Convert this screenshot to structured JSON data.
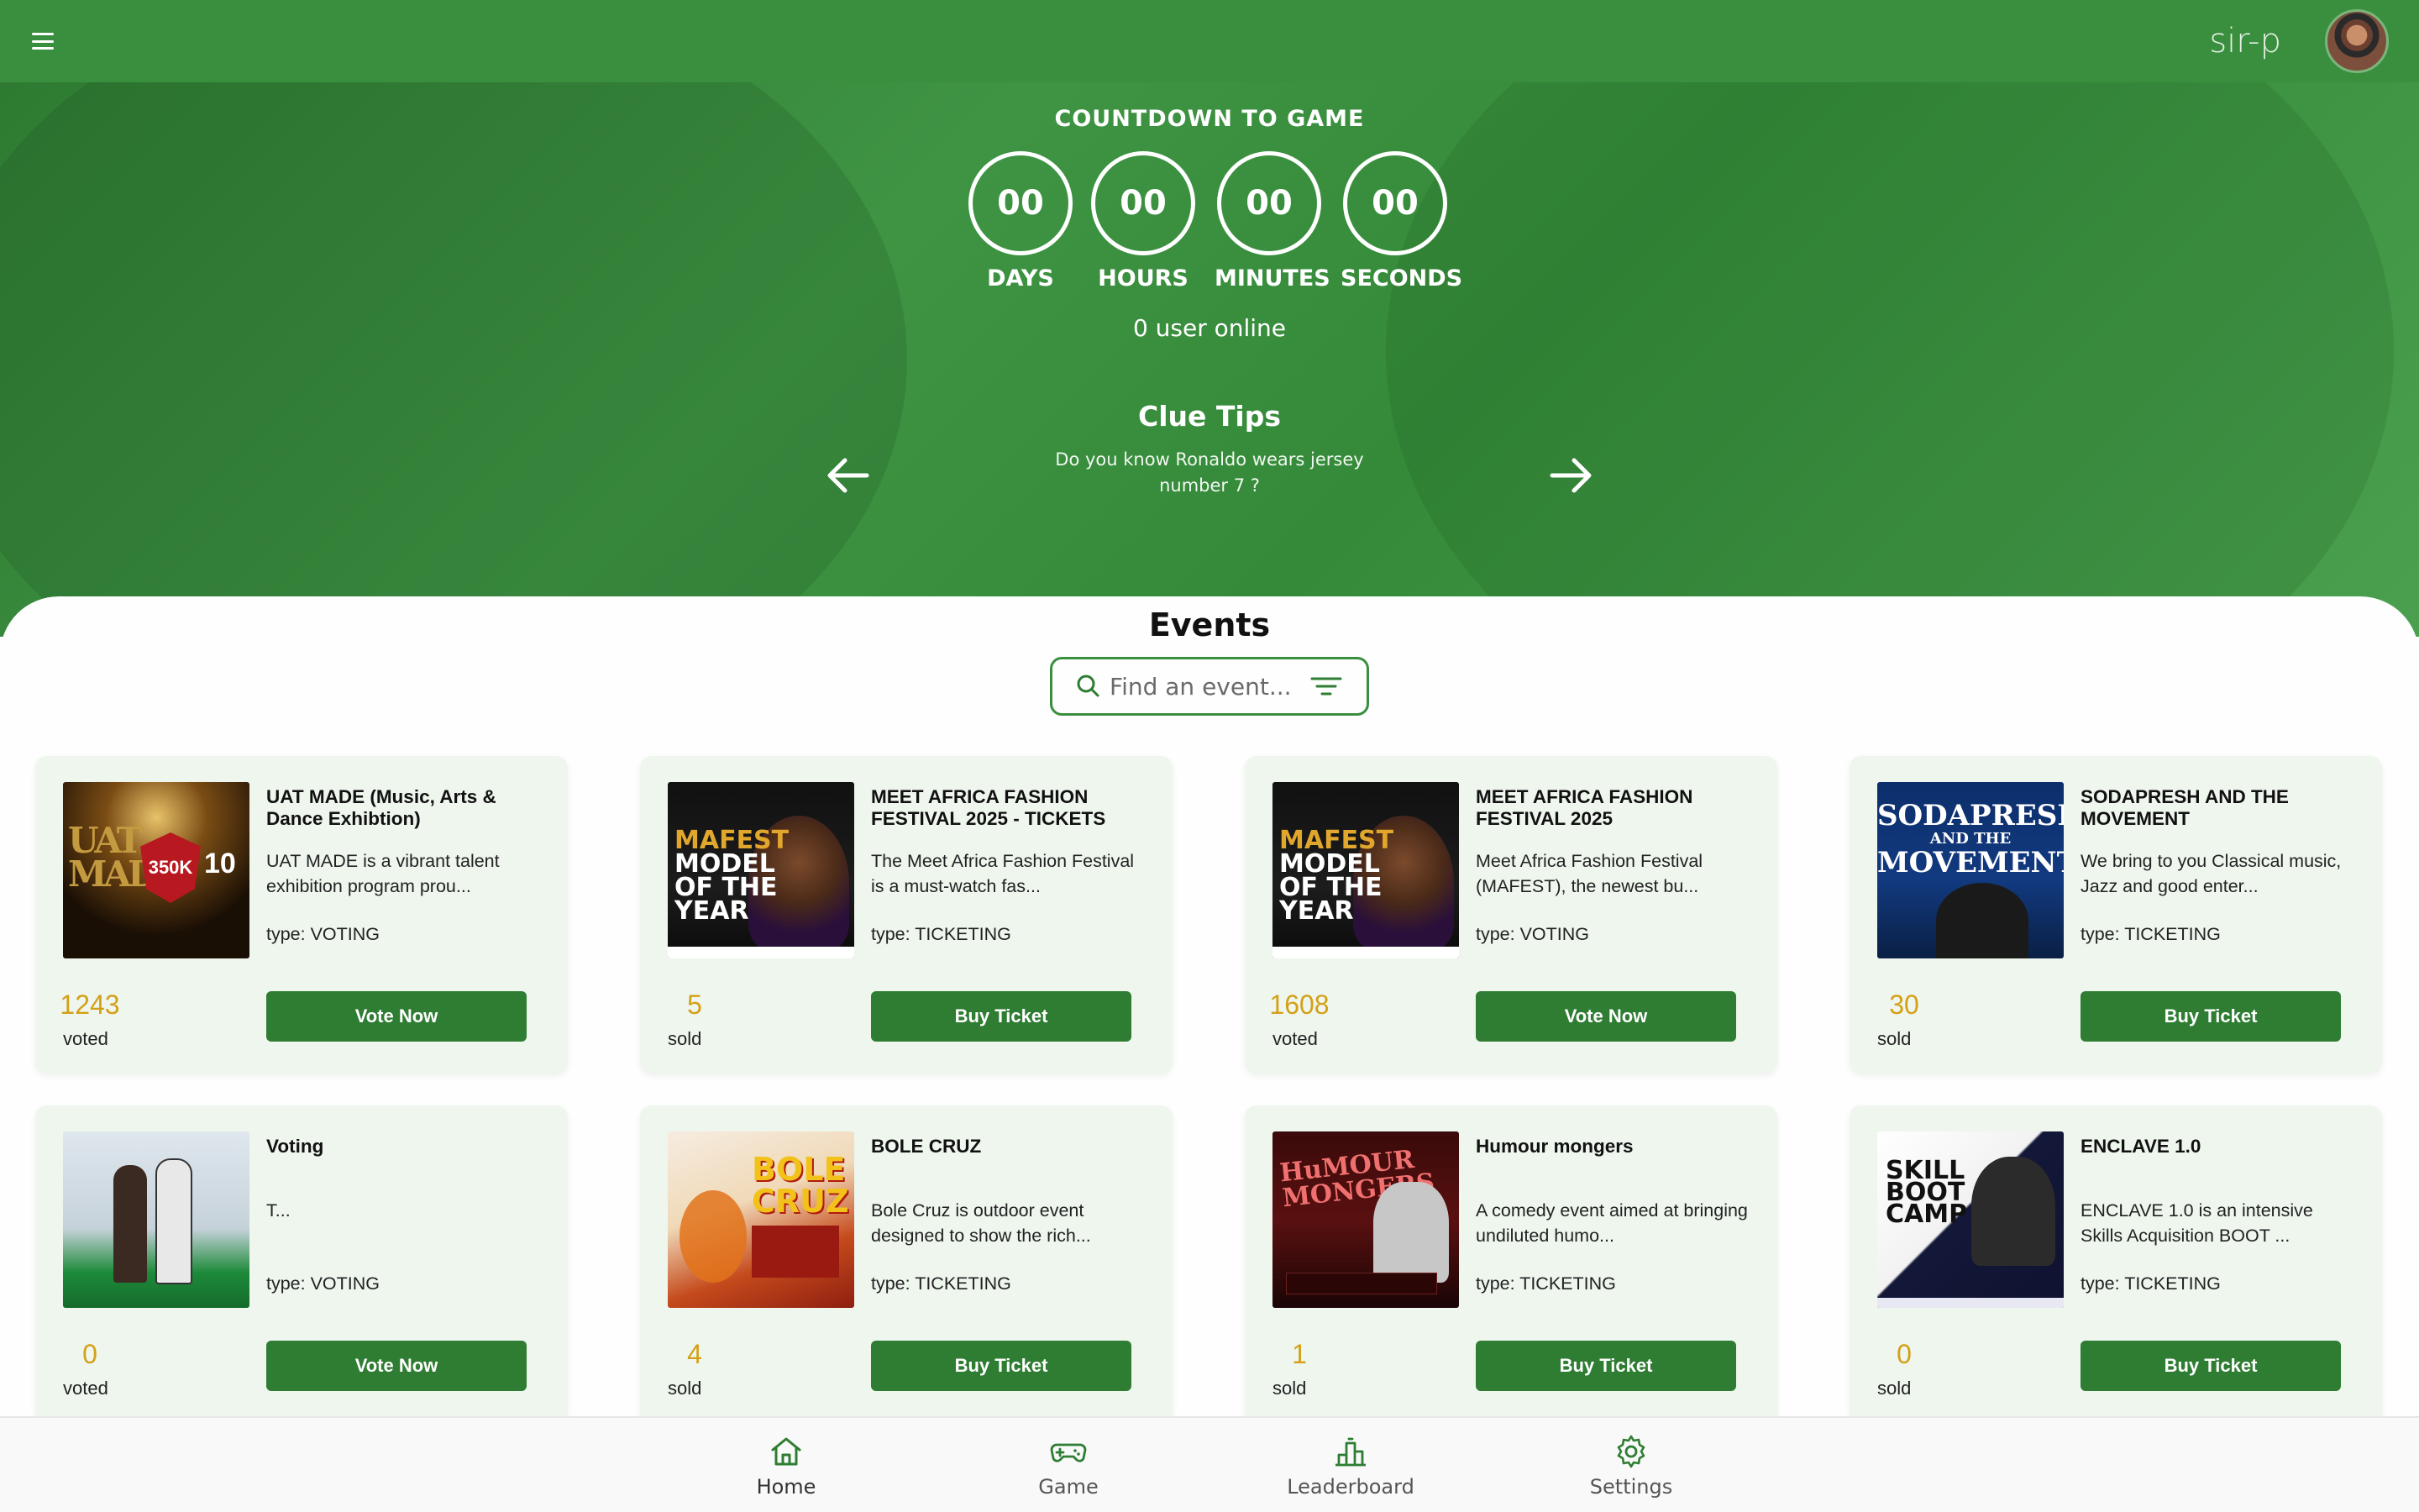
{
  "header": {
    "username": "sir-p"
  },
  "countdown": {
    "title": "COUNTDOWN TO GAME",
    "units": [
      {
        "value": "00",
        "label": "DAYS"
      },
      {
        "value": "00",
        "label": "HOURS"
      },
      {
        "value": "00",
        "label": "MINUTES"
      },
      {
        "value": "00",
        "label": "SECONDS"
      }
    ],
    "online": "0 user online"
  },
  "clue": {
    "title": "Clue Tips",
    "text": "Do you know Ronaldo wears jersey number 7 ?"
  },
  "events": {
    "title": "Events",
    "search_placeholder": "Find an event...",
    "cards": [
      {
        "title": "UAT MADE (Music, Arts & Dance Exhibtion)",
        "desc": "UAT MADE is a vibrant talent exhibition program prou...",
        "type": "type: VOTING",
        "count": "1243",
        "count_label": "voted",
        "button": "Vote Now"
      },
      {
        "title": "MEET AFRICA FASHION FESTIVAL 2025 - TICKETS",
        "desc": "The Meet Africa Fashion Festival is a must-watch fas...",
        "type": "type: TICKETING",
        "count": "5",
        "count_label": "sold",
        "button": "Buy Ticket"
      },
      {
        "title": "MEET AFRICA FASHION FESTIVAL 2025",
        "desc": "Meet Africa Fashion Festival (MAFEST), the newest bu...",
        "type": "type: VOTING",
        "count": "1608",
        "count_label": "voted",
        "button": "Vote Now"
      },
      {
        "title": "SODAPRESH AND THE MOVEMENT",
        "desc": "We bring to you Classical music, Jazz and good enter...",
        "type": "type: TICKETING",
        "count": "30",
        "count_label": "sold",
        "button": "Buy Ticket"
      },
      {
        "title": "Voting",
        "desc": "T...",
        "type": "type: VOTING",
        "count": "0",
        "count_label": "voted",
        "button": "Vote Now"
      },
      {
        "title": "BOLE CRUZ",
        "desc": "Bole Cruz is outdoor event designed to show the rich...",
        "type": "type: TICKETING",
        "count": "4",
        "count_label": "sold",
        "button": "Buy Ticket"
      },
      {
        "title": "Humour mongers",
        "desc": "A comedy event aimed at bringing undiluted humo...",
        "type": "type: TICKETING",
        "count": "1",
        "count_label": "sold",
        "button": "Buy Ticket"
      },
      {
        "title": "ENCLAVE 1.0",
        "desc": "ENCLAVE 1.0 is an intensive Skills Acquisition BOOT ...",
        "type": "type: TICKETING",
        "count": "0",
        "count_label": "sold",
        "button": "Buy Ticket"
      }
    ]
  },
  "thumbs": {
    "uat": {
      "big": "350K",
      "small": "10",
      "letters": "UAT MADE"
    },
    "mafest": {
      "lines": [
        "MAFEST",
        "MODEL",
        "OF THE",
        "YEAR"
      ]
    },
    "soda": {
      "lines": [
        "SODAPRESH",
        "AND THE",
        "MOVEMENT"
      ]
    },
    "bole": {
      "lines": [
        "BOLE",
        "CRUZ"
      ]
    },
    "humour": {
      "lines": [
        "HuMOUR",
        "MONGERS"
      ]
    },
    "enclave": {
      "lines": [
        "SKILL",
        "BOOT",
        "CAMP"
      ]
    }
  },
  "nav": [
    {
      "label": "Home",
      "icon": "home-icon"
    },
    {
      "label": "Game",
      "icon": "gamepad-icon"
    },
    {
      "label": "Leaderboard",
      "icon": "leaderboard-icon"
    },
    {
      "label": "Settings",
      "icon": "settings-icon"
    }
  ],
  "colors": {
    "primary": "#3a8f3e",
    "button": "#2e7d32",
    "count": "#d4a017"
  }
}
